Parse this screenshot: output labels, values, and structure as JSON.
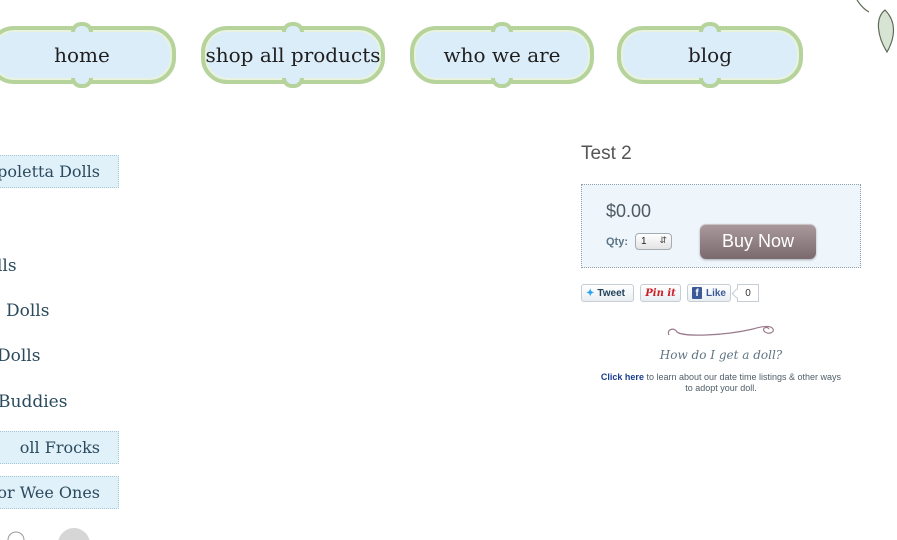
{
  "nav": {
    "tabs": [
      {
        "label": "home"
      },
      {
        "label": "shop all products"
      },
      {
        "label": "who we are"
      },
      {
        "label": "blog"
      }
    ]
  },
  "sidebar": {
    "items": [
      {
        "label": "poletta Dolls",
        "boxed": true
      },
      {
        "label": "lls",
        "boxed": false
      },
      {
        "label": "Dolls",
        "boxed": false
      },
      {
        "label": "Dolls",
        "boxed": false
      },
      {
        "label": "Buddies",
        "boxed": false
      },
      {
        "label": "oll Frocks",
        "boxed": true
      },
      {
        "label": "for Wee Ones",
        "boxed": true
      }
    ]
  },
  "product": {
    "title": "Test 2",
    "price": "$0.00",
    "qty_label": "Qty:",
    "qty_value": "1",
    "buy_label": "Buy Now"
  },
  "social": {
    "tweet_label": "Tweet",
    "pin_label": "Pin it",
    "like_label": "Like",
    "like_count": "0"
  },
  "info": {
    "heading": "How do I get a doll?",
    "link_text": "Click here",
    "body_text": " to learn about our date time listings & other ways to adopt your doll."
  },
  "colors": {
    "tab_fill": "#dcedfa",
    "tab_border": "#b5d39a",
    "buy_button": "#8a7a7d"
  }
}
